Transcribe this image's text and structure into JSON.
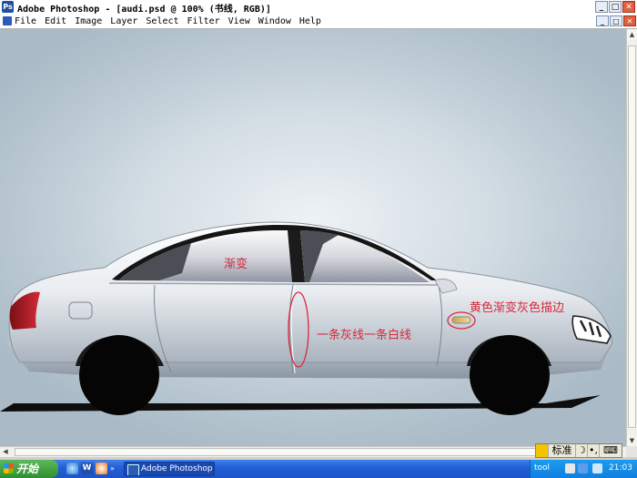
{
  "window": {
    "title": "Adobe Photoshop - [audi.psd @ 100% (书线, RGB)]",
    "min_label": "_",
    "restore_label": "□",
    "close_label": "✕"
  },
  "menu": [
    "File",
    "Edit",
    "Image",
    "Layer",
    "Select",
    "Filter",
    "View",
    "Window",
    "Help"
  ],
  "mdi": {
    "min_label": "_",
    "restore_label": "□",
    "close_label": "✕"
  },
  "annotations": {
    "gradient": "渐变",
    "yellow_gradient": "黄色渐变灰色描边",
    "gray_white_line": "一条灰线一条白线"
  },
  "ime": {
    "label": "标准"
  },
  "taskbar": {
    "start_label": "开始",
    "task_label": "Adobe Photoshop ...",
    "tray_text": "tool",
    "clock": "21:03"
  },
  "colors": {
    "annotation": "#d8283c",
    "car_body": "#e6e9ee",
    "taillight": "#c21e2a"
  },
  "icons": [
    "photoshop-icon",
    "ie-icon",
    "word-icon",
    "media-icon"
  ]
}
